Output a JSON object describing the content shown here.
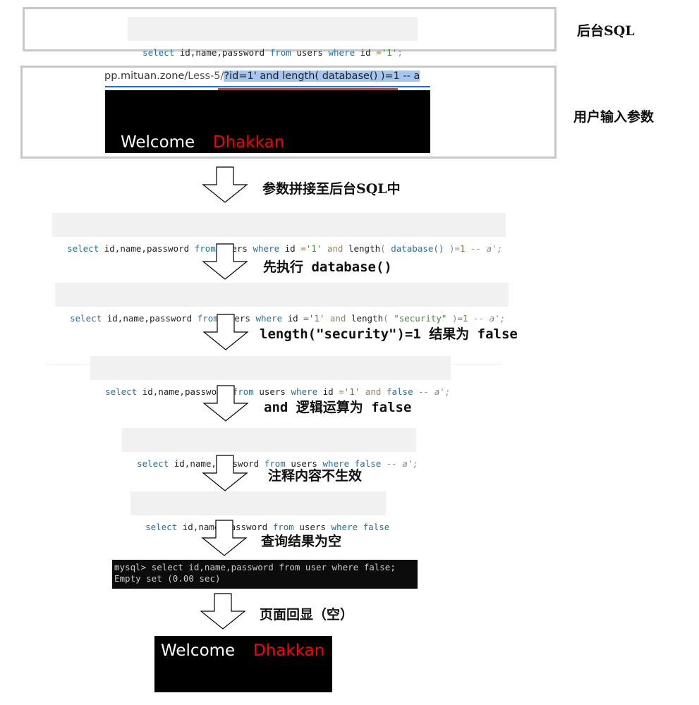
{
  "labels": {
    "backend_sql": "后台SQL",
    "user_input": "用户输入参数",
    "step1": "参数拼接至后台SQL中",
    "step2": "先执行 database()",
    "step3": "length(\"security\")=1 结果为 false",
    "step4": "and 逻辑运算为 false",
    "step5": "注释内容不生效",
    "step6": "查询结果为空",
    "step7": "页面回显（空）"
  },
  "original_sql": {
    "select": "select",
    "cols": " id,name,password ",
    "from": "from",
    "table": " users ",
    "where": "where",
    "id": " id ",
    "eq": "=",
    "val": "'1'",
    "end": ";"
  },
  "browser": {
    "url_prefix": "pp.mituan.zone/",
    "url_path": "Less-5/",
    "url_param": "?id=1' and length( database() )=1 -- a",
    "welcome": "Welcome",
    "user": "Dhakkan"
  },
  "sql_steps": {
    "s1": {
      "select": "select",
      "cols": " id,name,password ",
      "from": "from",
      "table": " users ",
      "where": "where",
      "id": " id ",
      "eq": "=",
      "val": "'1'",
      "and": " and ",
      "len": "length",
      "lp": "( ",
      "fn": "database()",
      "rp": " )=",
      "num": "1",
      "cm": " -- a';"
    },
    "s2": {
      "select": "select",
      "cols": " id,name,password ",
      "from": "from",
      "table": " users ",
      "where": "where",
      "id": " id ",
      "eq": "=",
      "val": "'1'",
      "and": " and ",
      "len": "length",
      "lp": "( ",
      "str": "\"security\"",
      "rp": " )=",
      "num": "1",
      "cm": " -- a';"
    },
    "s3": {
      "select": "select",
      "cols": " id,name,password ",
      "from": "from",
      "table": " users ",
      "where": "where",
      "id": " id ",
      "eq": "=",
      "val": "'1'",
      "and": " and ",
      "false": "false",
      "cm": " -- a';"
    },
    "s4": {
      "select": "select",
      "cols": " id,name,password ",
      "from": "from",
      "table": " users ",
      "where": "where",
      "false": " false",
      "cm": " -- a';"
    },
    "s5": {
      "select": "select",
      "cols": " id,name,password ",
      "from": "from",
      "table": " users ",
      "where": "where",
      "false": " false"
    }
  },
  "terminal": {
    "line1": "mysql> select id,name,password from user where false;",
    "line2": "Empty set (0.00 sec)"
  },
  "result_page": {
    "welcome": "Welcome",
    "user": "Dhakkan"
  },
  "colors": {
    "keyword": "#1f6fa8",
    "string": "#3c8f3c",
    "highlight": "#a6c6ef",
    "underline_red": "#f03030",
    "url_bar_blue": "#1e6fd0",
    "user_red": "#ff0000"
  }
}
